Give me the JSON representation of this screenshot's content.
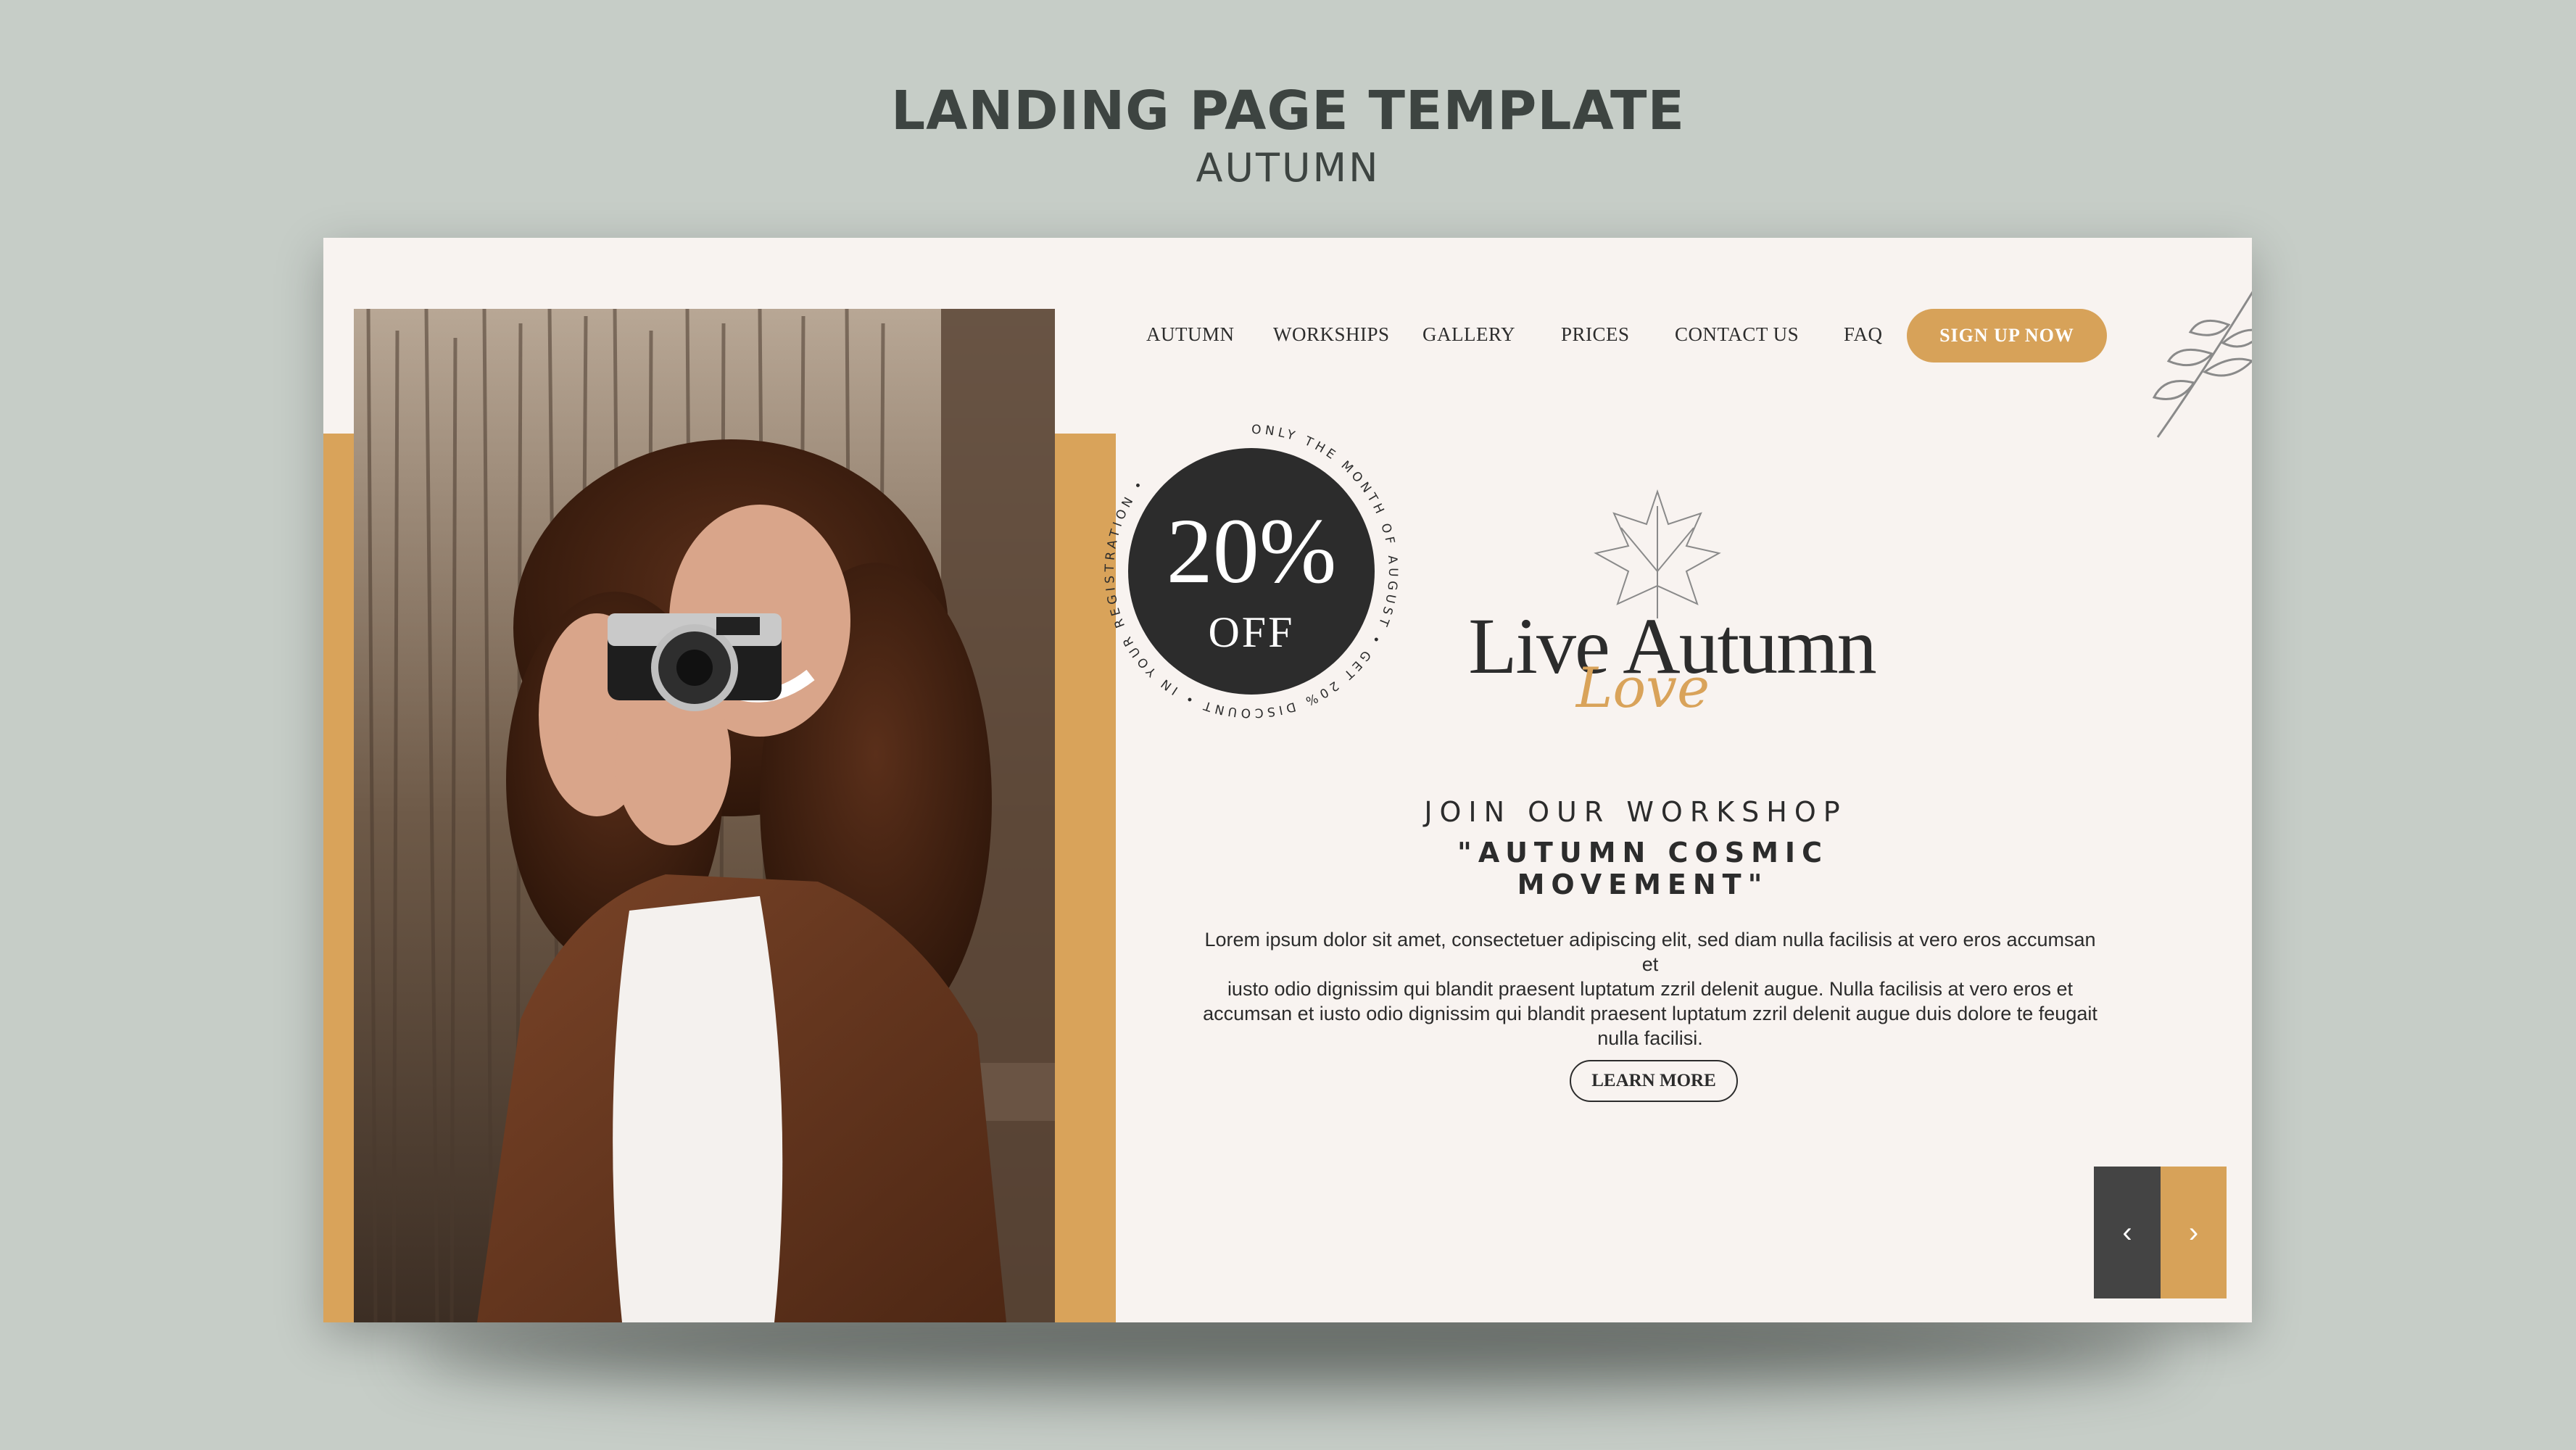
{
  "header": {
    "title": "LANDING PAGE TEMPLATE",
    "subtitle": "AUTUMN"
  },
  "nav": {
    "items": [
      {
        "label": "AUTUMN"
      },
      {
        "label": "WORKSHIPS"
      },
      {
        "label": "GALLERY"
      },
      {
        "label": "PRICES"
      },
      {
        "label": "CONTACT US"
      },
      {
        "label": "FAQ"
      }
    ],
    "signup_label": "SIGN UP NOW"
  },
  "badge": {
    "percent": "20%",
    "off": "OFF",
    "ring_text": "ONLY THE MONTH OF AUGUST • GET 20% DISCOUNT • IN YOUR REGISTRATION •"
  },
  "logo": {
    "main": "Live Autumn",
    "script": "Love"
  },
  "hero": {
    "line1": "JOIN OUR WORKSHOP",
    "line2": "\"AUTUMN COSMIC MOVEMENT\"",
    "body_lines": [
      "Lorem ipsum dolor sit amet, consectetuer adipiscing  elit, sed diam nulla facilisis at vero eros accumsan et",
      "iusto odio dignissim qui blandit praesent luptatum zzril delenit augue. Nulla facilisis at vero eros et",
      "accumsan et iusto odio dignissim qui blandit praesent luptatum zzril delenit augue duis dolore te feugait",
      "nulla facilisi."
    ],
    "learn_more": "LEARN MORE"
  },
  "slider": {
    "prev_icon": "chevron-left-icon",
    "next_icon": "chevron-right-icon",
    "prev_glyph": "‹",
    "next_glyph": "›"
  },
  "colors": {
    "background": "#c6cdc7",
    "card": "#f8f3f0",
    "accent": "#d7a259",
    "dark": "#2c2c2c"
  }
}
